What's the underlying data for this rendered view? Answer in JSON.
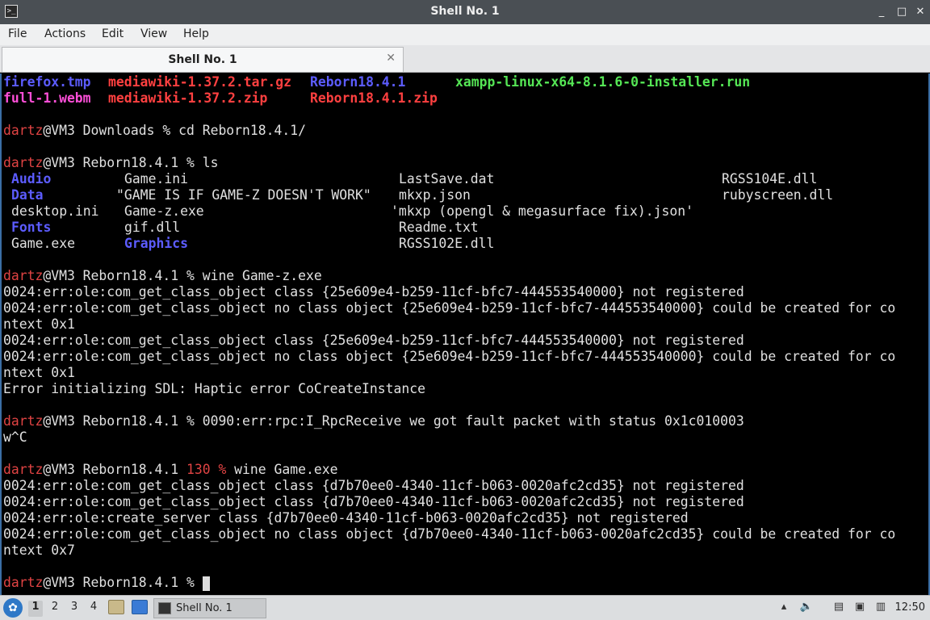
{
  "window": {
    "title": "Shell No. 1",
    "terminal_icon": ">_",
    "min_icon": "minimize-icon",
    "max_icon": "maximize-icon",
    "close_icon": "close-icon",
    "min_glyph": "_",
    "max_glyph": "□",
    "close_glyph": "✕"
  },
  "menu": [
    "File",
    "Actions",
    "Edit",
    "View",
    "Help"
  ],
  "tab": {
    "label": "Shell No. 1",
    "close": "✕"
  },
  "terminal": {
    "row1": [
      "firefox.tmp",
      "mediawiki-1.37.2.tar.gz",
      "Reborn18.4.1",
      "xampp-linux-x64-8.1.6-0-installer.run"
    ],
    "row2": [
      "full-1.webm",
      "mediawiki-1.37.2.zip",
      "Reborn18.4.1.zip"
    ],
    "prompt_user": "dartz",
    "p1_rest": "@VM3 Downloads % cd Reborn18.4.1/",
    "p2_rest": "@VM3 Reborn18.4.1 % ls",
    "ls": [
      [
        "Audio",
        "Game.ini",
        "LastSave.dat",
        "RGSS104E.dll"
      ],
      [
        "Data",
        "\"GAME IS IF GAME-Z DOESN'T WORK\"",
        "mkxp.json",
        "rubyscreen.dll"
      ],
      [
        "desktop.ini",
        "Game-z.exe",
        "'mkxp (opengl & megasurface fix).json'",
        ""
      ],
      [
        "Fonts",
        "gif.dll",
        "Readme.txt",
        ""
      ],
      [
        "Game.exe",
        "Graphics",
        "RGSS102E.dll",
        ""
      ]
    ],
    "p3_rest": "@VM3 Reborn18.4.1 % wine Game-z.exe",
    "out1": [
      "0024:err:ole:com_get_class_object class {25e609e4-b259-11cf-bfc7-444553540000} not registered",
      "0024:err:ole:com_get_class_object no class object {25e609e4-b259-11cf-bfc7-444553540000} could be created for co",
      "ntext 0x1",
      "0024:err:ole:com_get_class_object class {25e609e4-b259-11cf-bfc7-444553540000} not registered",
      "0024:err:ole:com_get_class_object no class object {25e609e4-b259-11cf-bfc7-444553540000} could be created for co",
      "ntext 0x1",
      "Error initializing SDL: Haptic error CoCreateInstance"
    ],
    "p4_rest": "@VM3 Reborn18.4.1 % 0090:err:rpc:I_RpcReceive we got fault packet with status 0x1c010003",
    "p4_cont": "w^C",
    "p5_mid": "@VM3 Reborn18.4.1 ",
    "p5_code": "130 %",
    "p5_cmd": " wine Game.exe",
    "out2": [
      "0024:err:ole:com_get_class_object class {d7b70ee0-4340-11cf-b063-0020afc2cd35} not registered",
      "0024:err:ole:com_get_class_object class {d7b70ee0-4340-11cf-b063-0020afc2cd35} not registered",
      "0024:err:ole:create_server class {d7b70ee0-4340-11cf-b063-0020afc2cd35} not registered",
      "0024:err:ole:com_get_class_object no class object {d7b70ee0-4340-11cf-b063-0020afc2cd35} could be created for co",
      "ntext 0x7"
    ],
    "p6_rest": "@VM3 Reborn18.4.1 % "
  },
  "taskbar": {
    "workspaces": [
      "1",
      "2",
      "3",
      "4"
    ],
    "task_label": "Shell No. 1",
    "clock": "12:50",
    "start_icon": "lxqt-menu-icon"
  },
  "colors": {
    "dir_blue": "#5c5cff",
    "media_pink": "#ff4fd8",
    "archive_red": "#ff4040",
    "exec_green": "#55e655",
    "prompt_red": "#e04343"
  }
}
